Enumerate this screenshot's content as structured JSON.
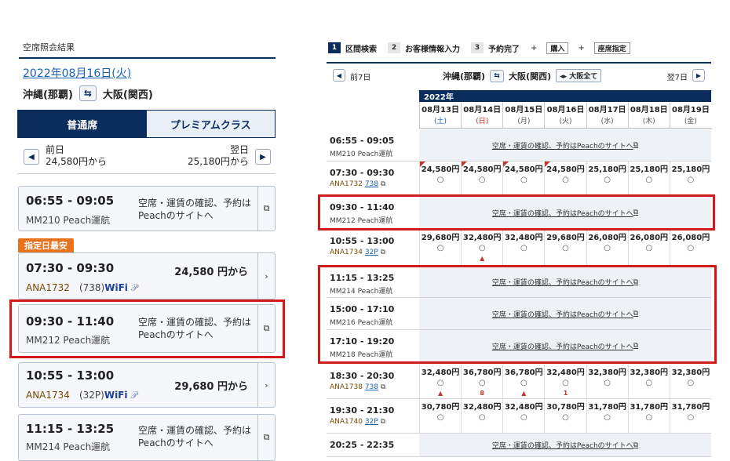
{
  "left": {
    "title": "空席照会結果",
    "date": "2022年08月16日(火)",
    "origin": "沖縄(那覇)",
    "destination": "大阪(関西)",
    "tabs": [
      "普通席",
      "プレミアムクラス"
    ],
    "prev_label": "前日",
    "prev_price": "24,580円から",
    "next_label": "翌日",
    "next_price": "25,180円から",
    "badge": "指定日最安",
    "cards": [
      {
        "time": "06:55 - 09:05",
        "flight": "MM210  Peach運航",
        "msg1": "空席・運賃の確認、予約は",
        "msg2": "Peachのサイトへ"
      },
      {
        "time": "07:30 - 09:30",
        "flight_no": "ANA1732",
        "aircraft": "(738)",
        "wifi": "WiFi",
        "price": "24,580 円から"
      },
      {
        "time": "09:30 - 11:40",
        "flight": "MM212  Peach運航",
        "msg1": "空席・運賃の確認、予約は",
        "msg2": "Peachのサイトへ"
      },
      {
        "time": "10:55 - 13:00",
        "flight_no": "ANA1734",
        "aircraft": "(32P)",
        "wifi": "WiFi",
        "price": "29,680 円から"
      },
      {
        "time": "11:15 - 13:25",
        "flight": "MM214  Peach運航",
        "msg1": "空席・運賃の確認、予約は",
        "msg2": "Peachのサイトへ"
      }
    ]
  },
  "right": {
    "steps": [
      {
        "num": "1",
        "label": "区間検索"
      },
      {
        "num": "2",
        "label": "お客様情報入力"
      },
      {
        "num": "3",
        "label": "予約完了"
      }
    ],
    "plus": "+",
    "step_boxes": [
      "購入",
      "座席指定"
    ],
    "prev_week": "前7日",
    "next_week": "翌7日",
    "origin": "沖縄(那覇)",
    "destination": "大阪(関西)",
    "osaka_all": "大阪全て",
    "year": "2022年",
    "dates": [
      {
        "d": "08月13日",
        "w": "(土)"
      },
      {
        "d": "08月14日",
        "w": "(日)"
      },
      {
        "d": "08月15日",
        "w": "(月)"
      },
      {
        "d": "08月16日",
        "w": "(火)"
      },
      {
        "d": "08月17日",
        "w": "(水)"
      },
      {
        "d": "08月18日",
        "w": "(木)"
      },
      {
        "d": "08月19日",
        "w": "(金)"
      }
    ],
    "peach_msg": "空席・運賃の確認、予約はPeachのサイトへ",
    "rows": [
      {
        "time": "06:55 - 09:05",
        "flt": "MM210  Peach運航",
        "type": "peach"
      },
      {
        "time": "07:30 - 09:30",
        "flt": "ANA1732",
        "ac": "738",
        "type": "ana",
        "prices": [
          "24,580円",
          "24,580円",
          "24,580円",
          "24,580円",
          "25,180円",
          "25,180円",
          "25,180円"
        ],
        "marks": [
          "○",
          "○",
          "○",
          "○",
          "○",
          "○",
          "○"
        ],
        "stock": [
          "",
          "",
          "",
          "",
          "",
          "",
          ""
        ]
      },
      {
        "time": "09:30 - 11:40",
        "flt": "MM212  Peach運航",
        "type": "peach"
      },
      {
        "time": "10:55 - 13:00",
        "flt": "ANA1734",
        "ac": "32P",
        "type": "ana",
        "prices": [
          "29,680円",
          "32,480円",
          "32,480円",
          "29,680円",
          "26,080円",
          "26,080円",
          "26,080円"
        ],
        "marks": [
          "○",
          "○",
          "○",
          "○",
          "○",
          "○",
          "○"
        ],
        "stock": [
          "",
          "▲",
          "",
          "",
          "",
          "",
          ""
        ]
      },
      {
        "time": "11:15 - 13:25",
        "flt": "MM214  Peach運航",
        "type": "peach"
      },
      {
        "time": "15:00 - 17:10",
        "flt": "MM216  Peach運航",
        "type": "peach"
      },
      {
        "time": "17:10 - 19:20",
        "flt": "MM218  Peach運航",
        "type": "peach"
      },
      {
        "time": "18:30 - 20:30",
        "flt": "ANA1738",
        "ac": "738",
        "type": "ana",
        "prices": [
          "32,480円",
          "36,780円",
          "36,780円",
          "32,480円",
          "32,380円",
          "32,380円",
          "32,380円"
        ],
        "marks": [
          "○",
          "○",
          "○",
          "○",
          "○",
          "○",
          "○"
        ],
        "stock": [
          "▲",
          "8",
          "▲",
          "1",
          "",
          "",
          ""
        ]
      },
      {
        "time": "19:30 - 21:30",
        "flt": "ANA1740",
        "ac": "32P",
        "type": "ana",
        "prices": [
          "30,780円",
          "32,480円",
          "32,480円",
          "30,780円",
          "31,780円",
          "31,780円",
          "31,780円"
        ],
        "marks": [
          "○",
          "○",
          "○",
          "○",
          "○",
          "○",
          "○"
        ],
        "stock": [
          "",
          "",
          "",
          "",
          "",
          "",
          ""
        ]
      },
      {
        "time": "20:25 - 22:35",
        "flt": "",
        "type": "peach"
      }
    ]
  }
}
